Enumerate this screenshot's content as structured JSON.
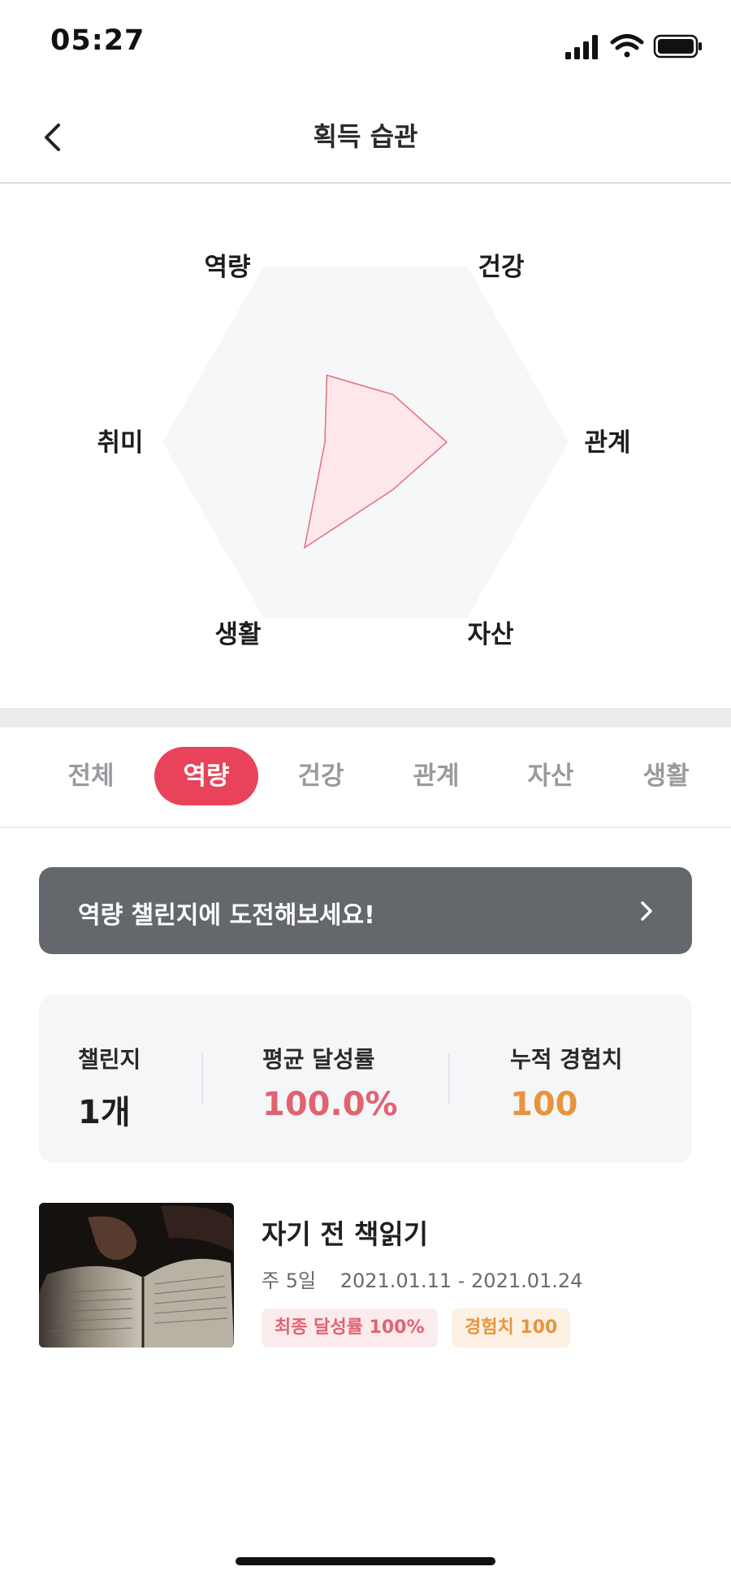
{
  "status_bar": {
    "time": "05:27"
  },
  "header": {
    "title": "획득 습관"
  },
  "radar": {
    "axes": [
      "역량",
      "건강",
      "관계",
      "자산",
      "생활",
      "취미"
    ],
    "values": [
      0.38,
      0.27,
      0.4,
      0.27,
      0.6,
      0.2
    ],
    "fill_color": "#fde7ea",
    "stroke_color": "#e07785",
    "background_color": "#f6f7f9"
  },
  "tabs": [
    {
      "label": "전체",
      "active": false
    },
    {
      "label": "역량",
      "active": true
    },
    {
      "label": "건강",
      "active": false
    },
    {
      "label": "관계",
      "active": false
    },
    {
      "label": "자산",
      "active": false
    },
    {
      "label": "생활",
      "active": false
    }
  ],
  "banner": {
    "text": "역량 챌린지에 도전해보세요!"
  },
  "stats": {
    "challenge_label": "챌린지",
    "challenge_value": "1개",
    "rate_label": "평균 달성률",
    "rate_value": "100.0%",
    "exp_label": "누적 경험치",
    "exp_value": "100",
    "colors": {
      "rate": "#e06372",
      "exp": "#e8943e"
    }
  },
  "challenges": [
    {
      "title": "자기 전 책읽기",
      "frequency": "주 5일",
      "period": "2021.01.11 - 2021.01.24",
      "rate_chip": "최종 달성률 100%",
      "exp_chip": "경험치 100"
    }
  ]
}
